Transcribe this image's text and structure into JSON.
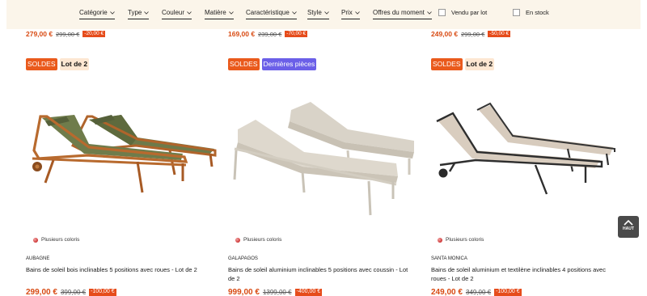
{
  "filters": {
    "items": [
      {
        "label": "Catégorie"
      },
      {
        "label": "Type"
      },
      {
        "label": "Couleur"
      },
      {
        "label": "Matière"
      },
      {
        "label": "Caractéristique"
      },
      {
        "label": "Style"
      },
      {
        "label": "Prix"
      },
      {
        "label": "Offres du moment"
      }
    ],
    "checkboxes": [
      {
        "label": "Vendu par lot",
        "checked": false
      },
      {
        "label": "En stock",
        "checked": false
      }
    ]
  },
  "top_prices": [
    {
      "price": "279,00 €",
      "old": "299,00 €",
      "discount": "-20,00 €"
    },
    {
      "price": "169,00 €",
      "old": "239,00 €",
      "discount": "-70,00 €"
    },
    {
      "price": "249,00 €",
      "old": "299,00 €",
      "discount": "-50,00 €"
    }
  ],
  "products": [
    {
      "badges": [
        {
          "label": "SOLDES",
          "kind": "soldes"
        },
        {
          "label": "Lot de 2",
          "kind": "lot"
        }
      ],
      "colors_label": "Plusieurs coloris",
      "brand": "AUBAGNE",
      "title": "Bains de soleil bois inclinables 5 positions avec roues - Lot de 2",
      "price": "299,00 €",
      "old": "399,00 €",
      "discount": "-100,00 €"
    },
    {
      "badges": [
        {
          "label": "SOLDES",
          "kind": "soldes"
        },
        {
          "label": "Dernières pièces",
          "kind": "last"
        }
      ],
      "colors_label": "Plusieurs coloris",
      "brand": "GALAPAGOS",
      "title": "Bains de soleil aluminium inclinables 5 positions avec coussin - Lot de 2",
      "price": "999,00 €",
      "old": "1399,00 €",
      "discount": "-400,00 €"
    },
    {
      "badges": [
        {
          "label": "SOLDES",
          "kind": "soldes"
        },
        {
          "label": "Lot de 2",
          "kind": "lot"
        }
      ],
      "colors_label": "Plusieurs coloris",
      "brand": "SANTA MONICA",
      "title": "Bains de soleil aluminium et textilène inclinables 4 positions avec roues - Lot de 2",
      "price": "249,00 €",
      "old": "349,00 €",
      "discount": "-100,00 €"
    }
  ],
  "back_to_top": {
    "label": "HAUT"
  },
  "icons": {
    "chevron": "chevron-down-icon",
    "top": "arrow-up-icon",
    "color_dot": "color-dot-icon"
  }
}
